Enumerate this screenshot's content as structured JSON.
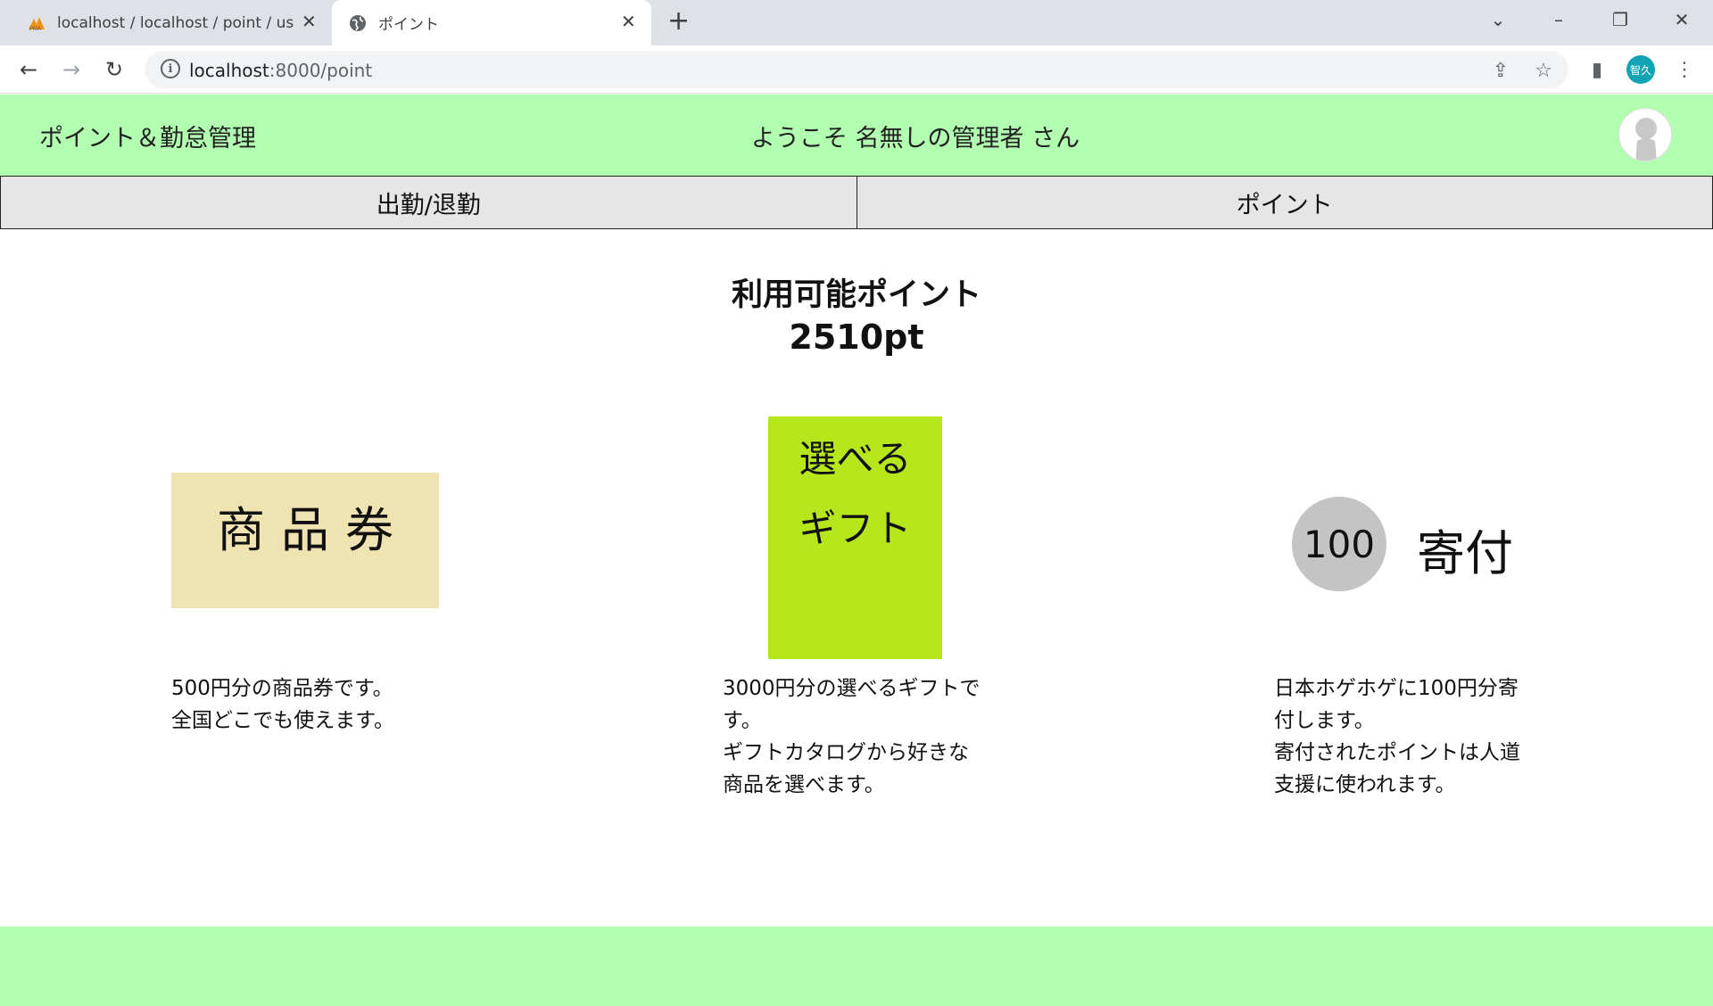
{
  "browser": {
    "tabs": [
      {
        "title": "localhost / localhost / point / use",
        "favicon": "phpmyadmin-icon",
        "active": false
      },
      {
        "title": "ポイント",
        "favicon": "globe-icon",
        "active": true
      }
    ],
    "url_host": "localhost",
    "url_path": ":8000/point",
    "profile_initials": "智久"
  },
  "header": {
    "title": "ポイント＆勤怠管理",
    "welcome": "ようこそ 名無しの管理者 さん"
  },
  "nav": {
    "tabs": [
      {
        "label": "出勤/退勤"
      },
      {
        "label": "ポイント"
      }
    ]
  },
  "points": {
    "label": "利用可能ポイント",
    "value": "2510pt"
  },
  "rewards": [
    {
      "image_text": "商品券",
      "description_lines": [
        "500円分の商品券です。",
        "全国どこでも使えます。"
      ]
    },
    {
      "image_text_line1": "選べる",
      "image_text_line2": "ギフト",
      "description_lines": [
        "3000円分の選べるギフトで",
        "す。",
        "ギフトカタログから好きな",
        "商品を選べます。"
      ]
    },
    {
      "image_badge": "100",
      "image_text": "寄付",
      "description_lines": [
        "日本ホゲホゲに100円分寄",
        "付します。",
        "寄付されたポイントは人道",
        "支援に使われます。"
      ]
    }
  ],
  "colors": {
    "header_bg": "#b2ffb2",
    "tab_bg": "#e6e6e6",
    "voucher_bg": "#f0e3b2",
    "gift_bg": "#b6e61c",
    "badge_bg": "#c4c4c4"
  }
}
